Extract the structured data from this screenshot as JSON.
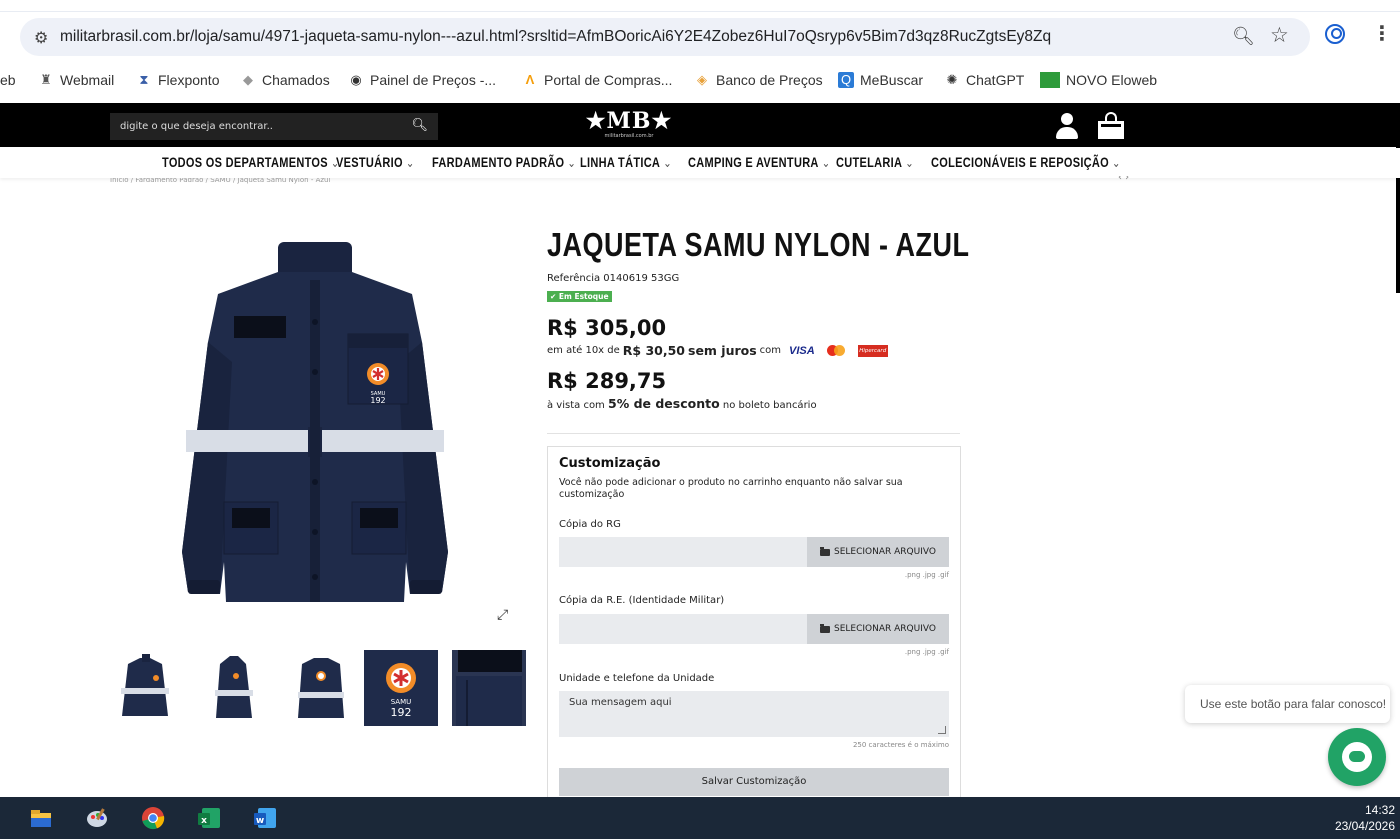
{
  "browser": {
    "url": "militarbrasil.com.br/loja/samu/4971-jaqueta-samu-nylon---azul.html?srsltid=AfmBOoricAi6Y2E4Zobez6HuI7oQsryp6v5Bim7d3qz8RucZgtsEy8Zq",
    "bookmarks": [
      "eb",
      "Webmail",
      "Flexponto",
      "Chamados",
      "Painel de Preços -...",
      "Portal de Compras...",
      "Banco de Preços",
      "MeBuscar",
      "ChatGPT",
      "NOVO Eloweb"
    ]
  },
  "header": {
    "search_placeholder": "digite o que deseja encontrar..",
    "logo": "★MB★",
    "logo_sub": "militarbrasil.com.br"
  },
  "nav": [
    "TODOS OS DEPARTAMENTOS",
    "VESTUÁRIO",
    "FARDAMENTO PADRÃO",
    "LINHA TÁTICA",
    "CAMPING E AVENTURA",
    "CUTELARIA",
    "COLECIONÁVEIS E REPOSIÇÃO"
  ],
  "breadcrumb": "Início / Fardamento Padrão / SAMU / Jaqueta Samu Nylon - Azul",
  "product": {
    "title": "JAQUETA SAMU NYLON - AZUL",
    "reference": "Referência 0140619 53GG",
    "stock": "✔ Em Estoque",
    "price": "R$ 305,00",
    "installment_prefix": "em até 10x de",
    "installment_value": "R$ 30,50",
    "installment_no_interest": "sem juros",
    "installment_with": "com",
    "card_visa": "VISA",
    "card_hiper": "Hipercard",
    "cash_price": "R$ 289,75",
    "cash_prefix": "à vista com",
    "cash_discount": "5% de desconto",
    "cash_suffix": "no boleto bancário",
    "badge_text": "SAMU",
    "badge_number": "192"
  },
  "customization": {
    "title": "Customização",
    "description": "Você não pode adicionar o produto no carrinho enquanto não salvar sua customização",
    "field1_label": "Cópia do RG",
    "field2_label": "Cópia da R.E. (Identidade Militar)",
    "file_button": "SELECIONAR ARQUIVO",
    "file_ext": ".png .jpg .gif",
    "field3_label": "Unidade e telefone da Unidade",
    "textarea_placeholder": "Sua mensagem aqui",
    "max_chars": "250 caracteres é o máximo",
    "save_button": "Salvar Customização"
  },
  "chat": {
    "bubble": "Use este botão para falar conosco!"
  },
  "taskbar": {
    "time": "14:32",
    "date": "23/04/2026"
  },
  "colors": {
    "jacket": "#1f2b4a",
    "stock_green": "#4caf50",
    "chat_green": "#21a366",
    "taskbar": "#1b2838"
  }
}
